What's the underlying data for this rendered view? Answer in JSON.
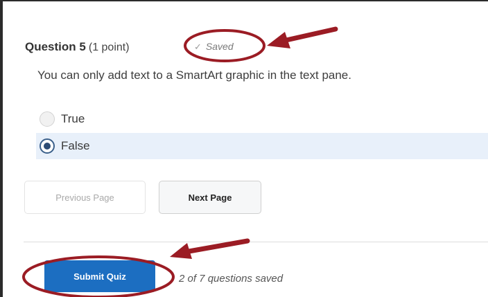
{
  "question": {
    "title": "Question 5",
    "points": "(1 point)",
    "status": "Saved",
    "text": "You can only add text to a SmartArt graphic in the text pane."
  },
  "options": [
    {
      "label": "True",
      "selected": false
    },
    {
      "label": "False",
      "selected": true
    }
  ],
  "navigation": {
    "previous_label": "Previous Page",
    "next_label": "Next Page"
  },
  "footer": {
    "submit_label": "Submit Quiz",
    "progress": "2 of 7 questions saved"
  },
  "colors": {
    "submit_button": "#1c6ec1",
    "selected_option_bg": "#e8f0fa",
    "annotation": "#9b1c24"
  },
  "icons": {
    "saved": "checkmark-icon"
  }
}
